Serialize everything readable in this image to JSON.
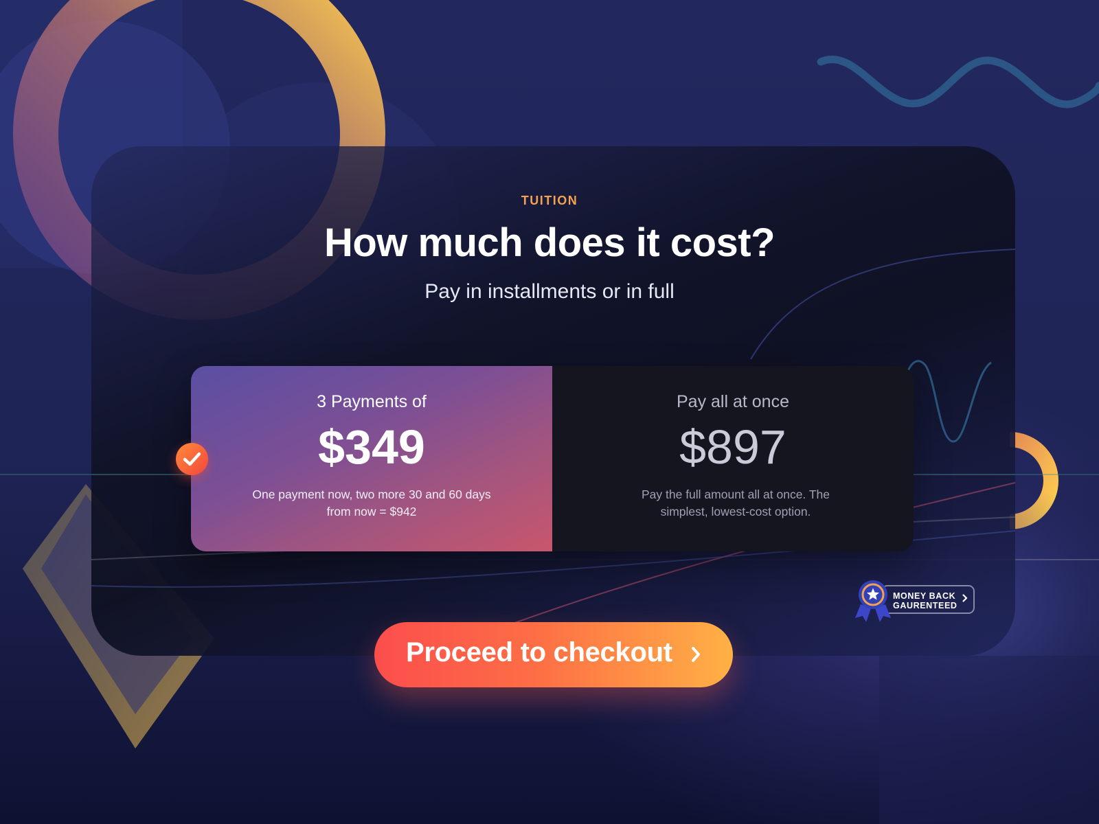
{
  "header": {
    "eyebrow": "TUITION",
    "title": "How much does it cost?",
    "subtitle": "Pay in installments or in full"
  },
  "plans": [
    {
      "label": "3 Payments of",
      "price": "$349",
      "description": "One payment now, two more 30 and 60 days from now = $942",
      "selected": true
    },
    {
      "label": "Pay all at once",
      "price": "$897",
      "description": "Pay the full amount all at once. The simplest, lowest-cost option.",
      "selected": false
    }
  ],
  "guarantee": {
    "line1": "MONEY BACK",
    "line2": "GAURENTEED"
  },
  "cta": {
    "label": "Proceed to checkout"
  },
  "icons": {
    "selected": "check-icon",
    "badge": "ribbon-medal-icon",
    "badge_arrow": "chevron-right-icon",
    "cta_arrow": "chevron-right-icon"
  },
  "colors": {
    "accent_orange": "#f4a252",
    "cta_start": "#fb4e4c",
    "cta_end": "#ffb145",
    "selected_plan_start": "#5a4fa3",
    "selected_plan_end": "#c8566c",
    "background": "#1f2456"
  }
}
